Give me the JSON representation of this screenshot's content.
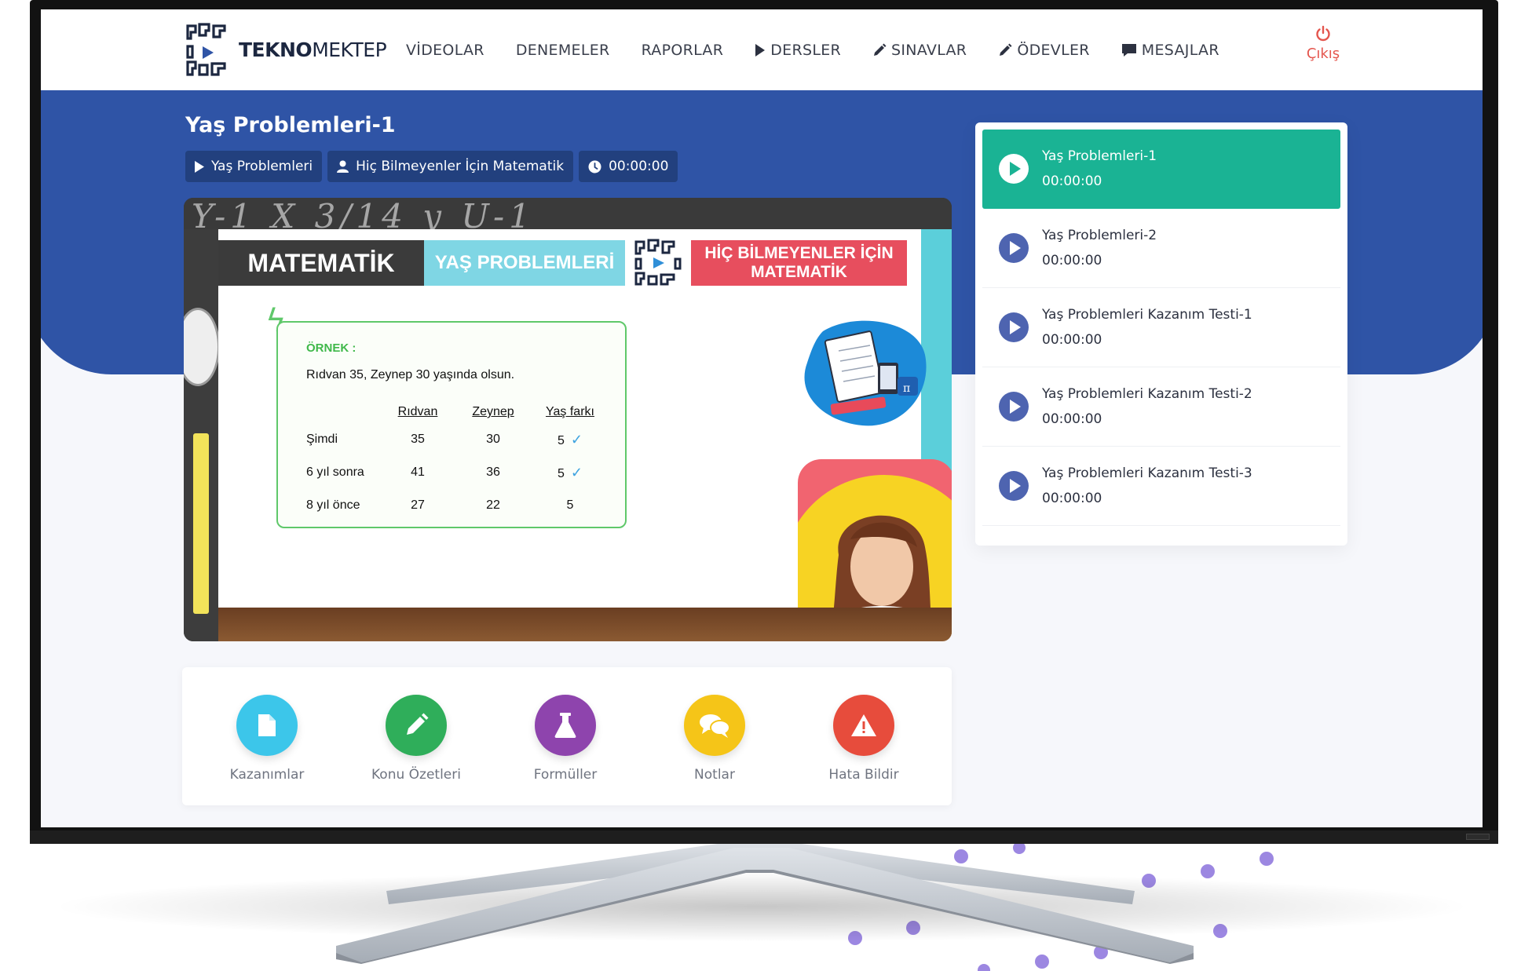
{
  "brand": {
    "name_bold": "TEKNO",
    "name_rest": "MEKTEP"
  },
  "nav": {
    "items": [
      {
        "label": "VİDEOLAR",
        "icon": ""
      },
      {
        "label": "DENEMELER",
        "icon": ""
      },
      {
        "label": "RAPORLAR",
        "icon": ""
      },
      {
        "label": "DERSLER",
        "icon": "play-icon"
      },
      {
        "label": "SINAVLAR",
        "icon": "pencil-icon"
      },
      {
        "label": "ÖDEVLER",
        "icon": "pencil-icon"
      },
      {
        "label": "MESAJLAR",
        "icon": "message-icon"
      }
    ],
    "logout_label": "Çıkış"
  },
  "lesson": {
    "title": "Yaş Problemleri-1",
    "topic": "Yaş Problemleri",
    "course": "Hiç Bilmeyenler İçin Matematik",
    "duration": "00:00:00"
  },
  "video": {
    "chalk_text": "Y-1 X  3/14 y   U-1",
    "header_subject": "MATEMATİK",
    "header_topic": "YAŞ PROBLEMLERİ",
    "header_series_line1": "HİÇ BİLMEYENLER İÇİN",
    "header_series_line2": "MATEMATİK",
    "example": {
      "heading": "ÖRNEK :",
      "statement": "Rıdvan 35, Zeynep 30 yaşında olsun.",
      "columns": [
        "Rıdvan",
        "Zeynep",
        "Yaş farkı"
      ],
      "rows": [
        {
          "label": "Şimdi",
          "values": [
            "35",
            "30",
            "5"
          ]
        },
        {
          "label": "6 yıl sonra",
          "values": [
            "41",
            "36",
            "5"
          ]
        },
        {
          "label": "8 yıl önce",
          "values": [
            "27",
            "22",
            "5"
          ]
        }
      ]
    }
  },
  "actions": [
    {
      "label": "Kazanımlar",
      "color": "#3cc6ea",
      "icon": "document-icon"
    },
    {
      "label": "Konu Özetleri",
      "color": "#2fae5a",
      "icon": "pencil-icon"
    },
    {
      "label": "Formüller",
      "color": "#8e44ad",
      "icon": "flask-icon"
    },
    {
      "label": "Notlar",
      "color": "#f5c518",
      "icon": "chat-bubbles-icon"
    },
    {
      "label": "Hata Bildir",
      "color": "#e74c3c",
      "icon": "warning-icon"
    }
  ],
  "playlist": [
    {
      "title": "Yaş Problemleri-1",
      "time": "00:00:00",
      "active": true
    },
    {
      "title": "Yaş Problemleri-2",
      "time": "00:00:00",
      "active": false
    },
    {
      "title": "Yaş Problemleri Kazanım Testi-1",
      "time": "00:00:00",
      "active": false
    },
    {
      "title": "Yaş Problemleri Kazanım Testi-2",
      "time": "00:00:00",
      "active": false
    },
    {
      "title": "Yaş Problemleri Kazanım Testi-3",
      "time": "00:00:00",
      "active": false
    }
  ],
  "colors": {
    "hero_blue": "#2f54a6",
    "active_green": "#1ab394",
    "play_icon_blue": "#4e64b0",
    "logout_red": "#e4564e"
  }
}
